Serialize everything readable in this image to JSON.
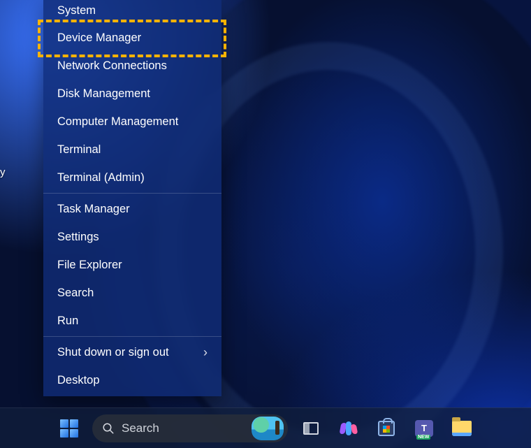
{
  "desktop": {
    "icon_label_fragment": "y"
  },
  "winx_menu": {
    "items_group1": [
      "System",
      "Device Manager",
      "Network Connections",
      "Disk Management",
      "Computer Management",
      "Terminal",
      "Terminal (Admin)"
    ],
    "items_group2": [
      "Task Manager",
      "Settings",
      "File Explorer",
      "Search",
      "Run"
    ],
    "items_group3": {
      "submenu_label": "Shut down or sign out",
      "desktop_label": "Desktop"
    },
    "highlighted_index": 1
  },
  "taskbar": {
    "search_placeholder": "Search",
    "icons": {
      "start": "start-button-icon",
      "search": "search-icon",
      "taskview": "task-view-icon",
      "copilot": "copilot-icon",
      "store": "microsoft-store-icon",
      "teams": "teams-icon",
      "explorer": "file-explorer-icon"
    },
    "teams_badge": "NEW",
    "teams_letter": "T"
  },
  "annotation": {
    "highlight_color": "#ffb300"
  }
}
